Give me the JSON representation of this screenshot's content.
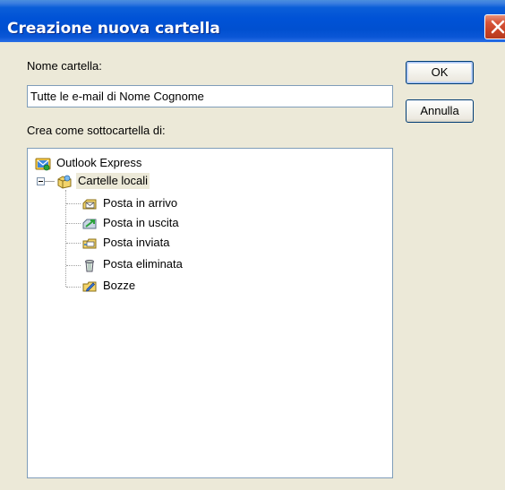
{
  "window": {
    "title": "Creazione nuova cartella"
  },
  "form": {
    "name_label": "Nome cartella:",
    "name_value": "Tutte le e-mail di Nome Cognome",
    "parent_label": "Crea come sottocartella di:"
  },
  "buttons": {
    "ok_label": "OK",
    "cancel_label": "Annulla"
  },
  "tree": {
    "root": {
      "label": "Outlook Express",
      "icon": "outlook-express-icon"
    },
    "local": {
      "label": "Cartelle locali",
      "icon": "local-folders-icon",
      "expanded": true,
      "selected": true
    },
    "children": [
      {
        "label": "Posta in arrivo",
        "icon": "inbox-icon"
      },
      {
        "label": "Posta in uscita",
        "icon": "outbox-icon"
      },
      {
        "label": "Posta inviata",
        "icon": "sent-items-icon"
      },
      {
        "label": "Posta eliminata",
        "icon": "deleted-items-icon"
      },
      {
        "label": "Bozze",
        "icon": "drafts-icon"
      }
    ]
  },
  "colors": {
    "titlebar": "#0054e3",
    "dialog_bg": "#ece9d8",
    "close_button": "#c64123",
    "field_border": "#7f9db9"
  }
}
